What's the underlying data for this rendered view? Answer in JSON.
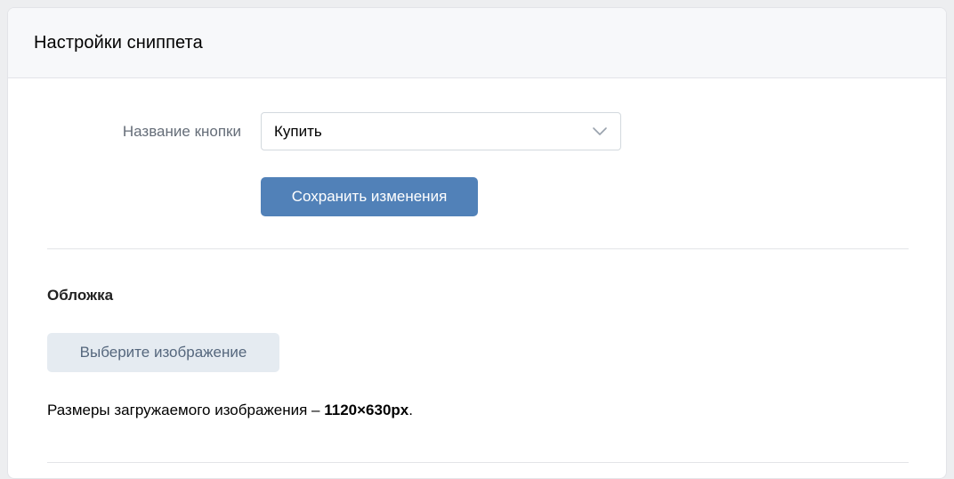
{
  "header": {
    "title": "Настройки сниппета"
  },
  "form": {
    "button_name_label": "Название кнопки",
    "button_name_value": "Купить",
    "save_label": "Сохранить изменения"
  },
  "cover": {
    "title": "Обложка",
    "choose_image_label": "Выберите изображение",
    "size_note_text": "Размеры загружаемого изображения – ",
    "size_note_value": "1120×630px",
    "size_note_end": "."
  },
  "icons": {
    "select_chevron": "chevron-down-icon"
  },
  "colors": {
    "primary_button": "#5181b8",
    "secondary_button": "#e5ebf1",
    "secondary_button_text": "#55677d",
    "label_text": "#656d78",
    "header_bg": "#f7f8fa",
    "page_bg": "#edeef0"
  }
}
